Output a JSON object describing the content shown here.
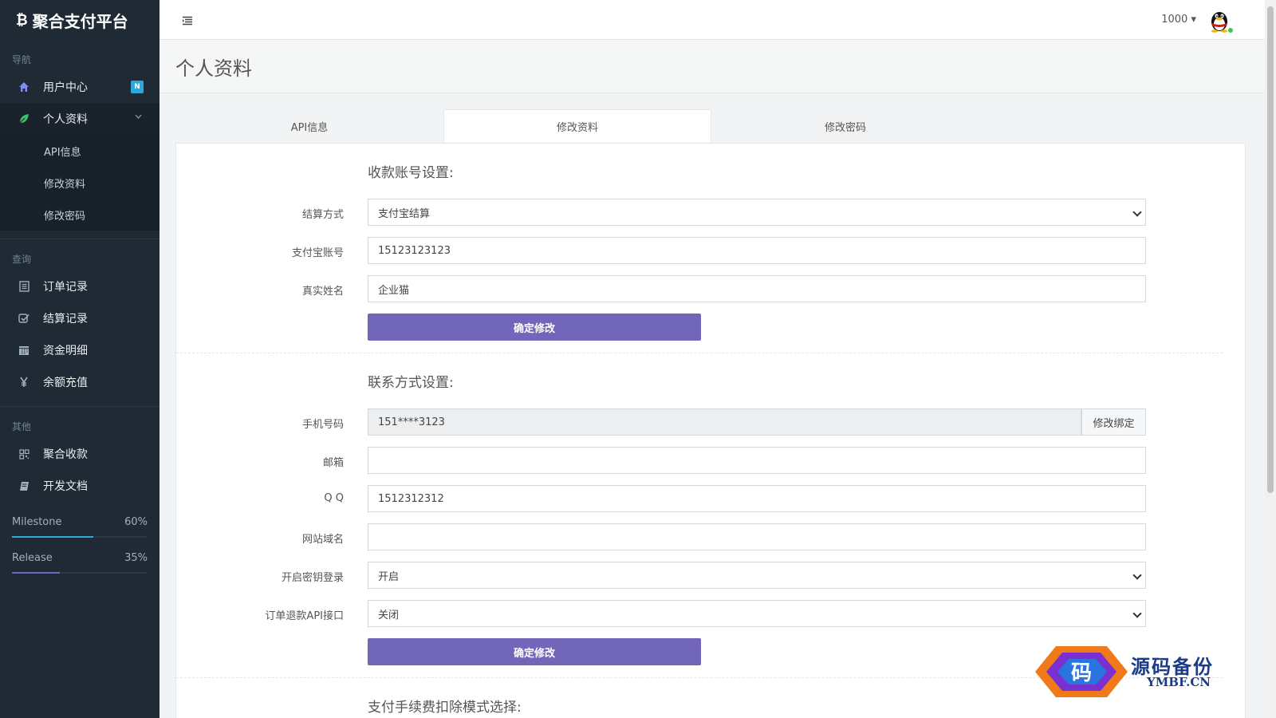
{
  "brand": {
    "logo_glyph": "₿",
    "title": "聚合支付平台"
  },
  "sidebar": {
    "sections": [
      {
        "header": "导航"
      },
      {
        "header": "查询"
      },
      {
        "header": "其他"
      }
    ],
    "nav": {
      "user_center": {
        "label": "用户中心",
        "badge": "N",
        "icon": "home-icon"
      },
      "profile": {
        "label": "个人资料",
        "icon": "leaf-icon",
        "children": [
          {
            "label": "API信息"
          },
          {
            "label": "修改资料"
          },
          {
            "label": "修改密码"
          }
        ]
      },
      "orders": {
        "label": "订单记录",
        "icon": "list-icon"
      },
      "settlements": {
        "label": "结算记录",
        "icon": "check-square-icon"
      },
      "funds": {
        "label": "资金明细",
        "icon": "calendar-icon"
      },
      "recharge": {
        "label": "余额充值",
        "icon": "yen-icon"
      },
      "aggregate_pay": {
        "label": "聚合收款",
        "icon": "qrcode-icon"
      },
      "dev_docs": {
        "label": "开发文档",
        "icon": "book-icon"
      }
    },
    "progress": [
      {
        "label": "Milestone",
        "value_text": "60%",
        "value": 0.6,
        "color": "#2ea7e0"
      },
      {
        "label": "Release",
        "value_text": "35%",
        "value": 0.35,
        "color": "#7266ba"
      }
    ]
  },
  "topbar": {
    "menu_icon": "menu-toggle-icon",
    "user": "1000",
    "caret": "▾"
  },
  "page": {
    "title": "个人资料"
  },
  "tabs": [
    {
      "label": "API信息"
    },
    {
      "label": "修改资料",
      "active": true
    },
    {
      "label": "修改密码"
    }
  ],
  "account_section": {
    "title": "收款账号设置:",
    "settle_method": {
      "label": "结算方式",
      "value": "支付宝结算"
    },
    "alipay_account": {
      "label": "支付宝账号",
      "value": "15123123123"
    },
    "real_name": {
      "label": "真实姓名",
      "value": "企业猫"
    },
    "submit": "确定修改"
  },
  "contact_section": {
    "title": "联系方式设置:",
    "phone": {
      "label": "手机号码",
      "value": "151****3123",
      "addon": "修改绑定"
    },
    "email": {
      "label": "邮箱",
      "value": ""
    },
    "qq": {
      "label": "Q Q",
      "value": "1512312312"
    },
    "website": {
      "label": "网站域名",
      "value": ""
    },
    "key_login": {
      "label": "开启密钥登录",
      "value": "开启"
    },
    "refund_api": {
      "label": "订单退款API接口",
      "value": "关闭"
    },
    "submit": "确定修改"
  },
  "fee_section": {
    "title": "支付手续费扣除模式选择:"
  },
  "watermark": {
    "glyph": "码",
    "site": "源码备份",
    "url": "YMBF.CN"
  },
  "colors": {
    "sidebar_bg": "#1f2a35",
    "accent": "#7266ba",
    "badge": "#2ea7e0"
  }
}
